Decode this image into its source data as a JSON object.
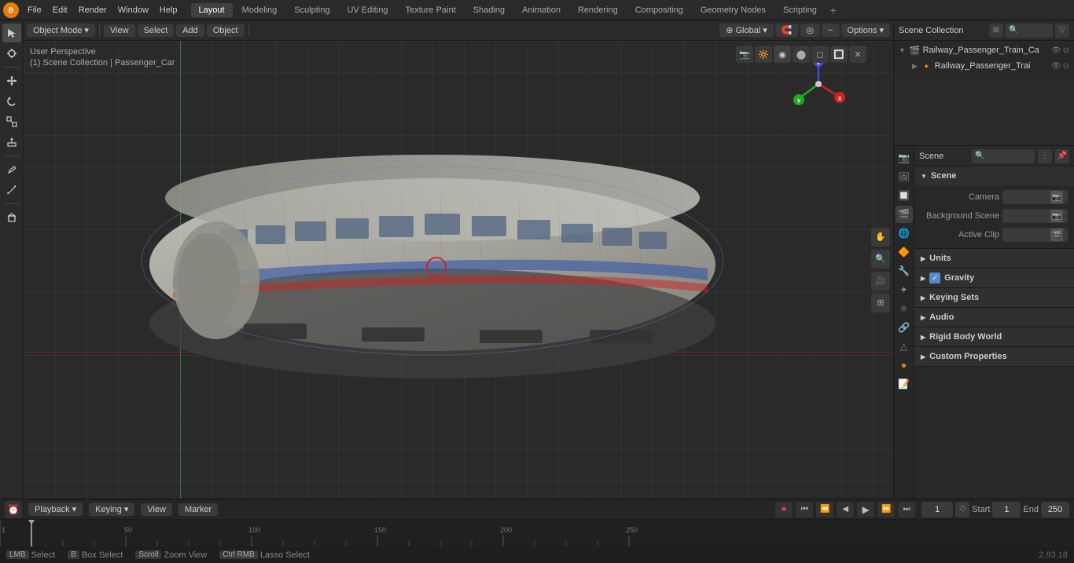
{
  "topbar": {
    "logo": "B",
    "menus": [
      "File",
      "Edit",
      "Render",
      "Window",
      "Help"
    ],
    "workspace_tabs": [
      "Layout",
      "Modeling",
      "Sculpting",
      "UV Editing",
      "Texture Paint",
      "Shading",
      "Animation",
      "Rendering",
      "Compositing",
      "Geometry Nodes",
      "Scripting"
    ],
    "active_tab": "Layout",
    "add_tab_label": "+"
  },
  "viewport": {
    "mode_label": "Object Mode",
    "view_label": "View",
    "select_label": "Select",
    "add_label": "Add",
    "object_label": "Object",
    "transform": "Global",
    "user_perspective": "User Perspective",
    "breadcrumb": "(1) Scene Collection | Passenger_Car",
    "options_label": "Options"
  },
  "outliner": {
    "title": "Scene Collection",
    "search_placeholder": "Search...",
    "items": [
      {
        "name": "Railway_Passenger_Train_Ca",
        "level": 0,
        "expanded": true,
        "icon": "📷"
      },
      {
        "name": "Railway_Passenger_Trai",
        "level": 1,
        "expanded": false,
        "icon": "🔶"
      }
    ]
  },
  "properties": {
    "tabs": [
      {
        "id": "render",
        "icon": "📷",
        "label": "Render"
      },
      {
        "id": "output",
        "icon": "🖼",
        "label": "Output"
      },
      {
        "id": "view_layer",
        "icon": "🔲",
        "label": "View Layer"
      },
      {
        "id": "scene",
        "icon": "🎬",
        "label": "Scene"
      },
      {
        "id": "world",
        "icon": "🌐",
        "label": "World"
      },
      {
        "id": "object",
        "icon": "🔶",
        "label": "Object"
      },
      {
        "id": "modifier",
        "icon": "🔧",
        "label": "Modifier"
      },
      {
        "id": "particles",
        "icon": "✦",
        "label": "Particles"
      },
      {
        "id": "physics",
        "icon": "⚛",
        "label": "Physics"
      },
      {
        "id": "constraints",
        "icon": "🔗",
        "label": "Constraints"
      },
      {
        "id": "data",
        "icon": "△",
        "label": "Data"
      },
      {
        "id": "material",
        "icon": "●",
        "label": "Material"
      },
      {
        "id": "scripting2",
        "icon": "📝",
        "label": "Scripting"
      }
    ],
    "active_tab": "scene",
    "header_label": "Scene",
    "search_placeholder": "Search...",
    "sections": {
      "scene": {
        "title": "Scene",
        "camera_label": "Camera",
        "camera_value": "",
        "background_scene_label": "Background Scene",
        "background_scene_value": "",
        "active_clip_label": "Active Clip",
        "active_clip_value": ""
      },
      "units": {
        "title": "Units",
        "collapsed": true
      },
      "gravity": {
        "title": "Gravity",
        "checked": true,
        "label": "Gravity"
      },
      "keying_sets": {
        "title": "Keying Sets",
        "collapsed": true
      },
      "audio": {
        "title": "Audio",
        "collapsed": true
      },
      "rigid_body_world": {
        "title": "Rigid Body World",
        "collapsed": true
      },
      "custom_properties": {
        "title": "Custom Properties",
        "collapsed": true
      }
    }
  },
  "timeline": {
    "playback_label": "Playback",
    "keying_label": "Keying",
    "view_label": "View",
    "marker_label": "Marker",
    "frame_current": "1",
    "record_icon": "⏺",
    "start_label": "Start",
    "start_value": "1",
    "end_label": "End",
    "end_value": "250",
    "ruler_marks": [
      "1",
      "50",
      "100",
      "150",
      "200",
      "250"
    ],
    "play_controls": [
      "⏮",
      "⏪",
      "◀",
      "▶",
      "⏩",
      "⏭"
    ]
  },
  "statusbar": {
    "select_label": "Select",
    "box_select_label": "Box Select",
    "zoom_view_label": "Zoom View",
    "lasso_label": "Lasso Select",
    "version": "2.93.18"
  },
  "gizmo": {
    "x_color": "#cc3333",
    "y_color": "#33cc33",
    "z_color": "#3333cc",
    "x_label": "X",
    "y_label": "Y",
    "z_label": "Z"
  }
}
